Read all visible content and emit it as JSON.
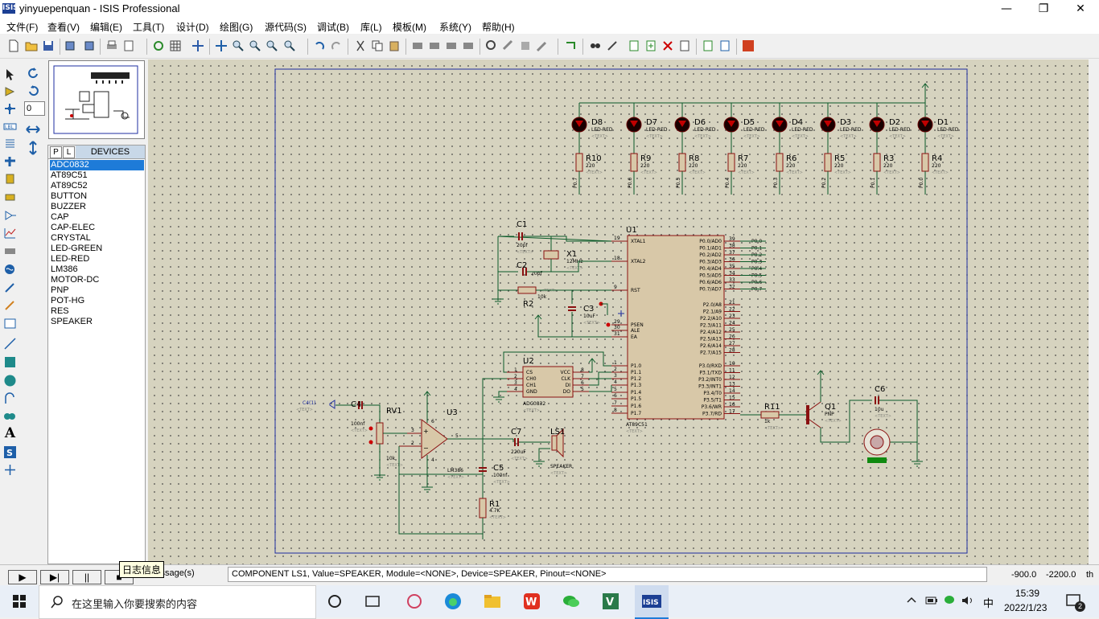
{
  "window": {
    "title": "yinyuepenquan - ISIS Professional",
    "icon_text": "ISIS"
  },
  "menu": [
    "文件(F)",
    "查看(V)",
    "编辑(E)",
    "工具(T)",
    "设计(D)",
    "绘图(G)",
    "源代码(S)",
    "调试(B)",
    "库(L)",
    "模板(M)",
    "系统(Y)",
    "帮助(H)"
  ],
  "left_tools2": {
    "rotation_value": "0"
  },
  "devices": {
    "tab_p": "P",
    "tab_l": "L",
    "title": "DEVICES",
    "items": [
      "ADC0832",
      "AT89C51",
      "AT89C52",
      "BUTTON",
      "BUZZER",
      "CAP",
      "CAP-ELEC",
      "CRYSTAL",
      "LED-GREEN",
      "LED-RED",
      "LM386",
      "MOTOR-DC",
      "PNP",
      "POT-HG",
      "RES",
      "SPEAKER"
    ],
    "selected": "ADC0832"
  },
  "schematic": {
    "leds": [
      {
        "ref": "D8",
        "type": "LED-RED",
        "res": "R10",
        "net": "P0.7"
      },
      {
        "ref": "D7",
        "type": "LED-RED",
        "res": "R9",
        "net": "P0.6"
      },
      {
        "ref": "D6",
        "type": "LED-RED",
        "res": "R8",
        "net": "P0.5"
      },
      {
        "ref": "D5",
        "type": "LED-RED",
        "res": "R7",
        "net": "P0.4"
      },
      {
        "ref": "D4",
        "type": "LED-RED",
        "res": "R6",
        "net": "P0.3"
      },
      {
        "ref": "D3",
        "type": "LED-RED",
        "res": "R5",
        "net": "P0.2"
      },
      {
        "ref": "D2",
        "type": "LED-RED",
        "res": "R3",
        "net": "P0.1"
      },
      {
        "ref": "D1",
        "type": "LED-RED",
        "res": "R4",
        "net": "P0.0"
      }
    ],
    "res_value": "220",
    "text_placeholder": "<TEXT>",
    "u1": {
      "ref": "U1",
      "part": "AT89C51",
      "left_pins": [
        [
          "19",
          "XTAL1"
        ],
        [
          "18",
          "XTAL2"
        ],
        [
          "9",
          "RST"
        ],
        [
          "29",
          "PSEN"
        ],
        [
          "30",
          "ALE"
        ],
        [
          "31",
          "EA"
        ],
        [
          "1",
          "P1.0"
        ],
        [
          "2",
          "P1.1"
        ],
        [
          "3",
          "P1.2"
        ],
        [
          "4",
          "P1.3"
        ],
        [
          "5",
          "P1.4"
        ],
        [
          "6",
          "P1.5"
        ],
        [
          "7",
          "P1.6"
        ],
        [
          "8",
          "P1.7"
        ]
      ],
      "p0_pins": [
        [
          "39",
          "P0.0/AD0"
        ],
        [
          "38",
          "P0.1/AD1"
        ],
        [
          "37",
          "P0.2/AD2"
        ],
        [
          "36",
          "P0.3/AD3"
        ],
        [
          "35",
          "P0.4/AD4"
        ],
        [
          "34",
          "P0.5/AD5"
        ],
        [
          "33",
          "P0.6/AD6"
        ],
        [
          "32",
          "P0.7/AD7"
        ]
      ],
      "p2_pins": [
        [
          "21",
          "P2.0/A8"
        ],
        [
          "22",
          "P2.1/A9"
        ],
        [
          "23",
          "P2.2/A10"
        ],
        [
          "24",
          "P2.3/A11"
        ],
        [
          "25",
          "P2.4/A12"
        ],
        [
          "26",
          "P2.5/A13"
        ],
        [
          "27",
          "P2.6/A14"
        ],
        [
          "28",
          "P2.7/A15"
        ]
      ],
      "p3_pins": [
        [
          "10",
          "P3.0/RXD"
        ],
        [
          "11",
          "P3.1/TXD"
        ],
        [
          "12",
          "P3.2/INT0"
        ],
        [
          "13",
          "P3.3/INT1"
        ],
        [
          "14",
          "P3.4/T0"
        ],
        [
          "15",
          "P3.5/T1"
        ],
        [
          "16",
          "P3.6/WR"
        ],
        [
          "17",
          "P3.7/RD"
        ]
      ],
      "p0_nets": [
        "P0.0",
        "P0.1",
        "P0.2",
        "P0.3",
        "P0.4",
        "P0.5",
        "P0.6",
        "P0.7"
      ]
    },
    "c1": {
      "ref": "C1",
      "value": "20pf"
    },
    "c2": {
      "ref": "C2",
      "value": "20pf"
    },
    "x1": {
      "ref": "X1",
      "value": "12MHz"
    },
    "r2": {
      "ref": "R2",
      "value": "10k"
    },
    "c3": {
      "ref": "C3",
      "value": "10uF"
    },
    "u2": {
      "ref": "U2",
      "part": "ADC0832",
      "left_pins": [
        [
          "1",
          "CS"
        ],
        [
          "2",
          "CH0"
        ],
        [
          "3",
          "CH1"
        ],
        [
          "4",
          "GND"
        ]
      ],
      "right_pins": [
        [
          "8",
          "VCC"
        ],
        [
          "7",
          "CLK"
        ],
        [
          "6",
          "DI"
        ],
        [
          "5",
          "DO"
        ]
      ]
    },
    "c4": {
      "ref": "C4",
      "value": "100nf"
    },
    "rv1": {
      "ref": "RV1",
      "value": "10k"
    },
    "u3": {
      "ref": "U3",
      "part": "LM386"
    },
    "c7": {
      "ref": "C7",
      "value": "220uF"
    },
    "ls1": {
      "ref": "LS1",
      "part": "SPEAKER"
    },
    "c5": {
      "ref": "C5",
      "value": "100nf"
    },
    "r1": {
      "ref": "R1",
      "value": "4.7K"
    },
    "r11": {
      "ref": "R11",
      "value": "1k"
    },
    "q1": {
      "ref": "Q1",
      "part": "PNP"
    },
    "c6": {
      "ref": "C6",
      "value": "10u"
    },
    "c4_net": "C4(1)"
  },
  "status": {
    "tooltip": "日志信息",
    "messages": "4 Message(s)",
    "text": "COMPONENT LS1, Value=SPEAKER, Module=<NONE>, Device=SPEAKER, Pinout=<NONE>",
    "x": "-900.0",
    "y": "-2200.0",
    "units": "th"
  },
  "taskbar": {
    "search_placeholder": "在这里输入你要搜索的内容",
    "time": "15:39",
    "date": "2022/1/23",
    "ime": "中",
    "notifications": "2"
  }
}
